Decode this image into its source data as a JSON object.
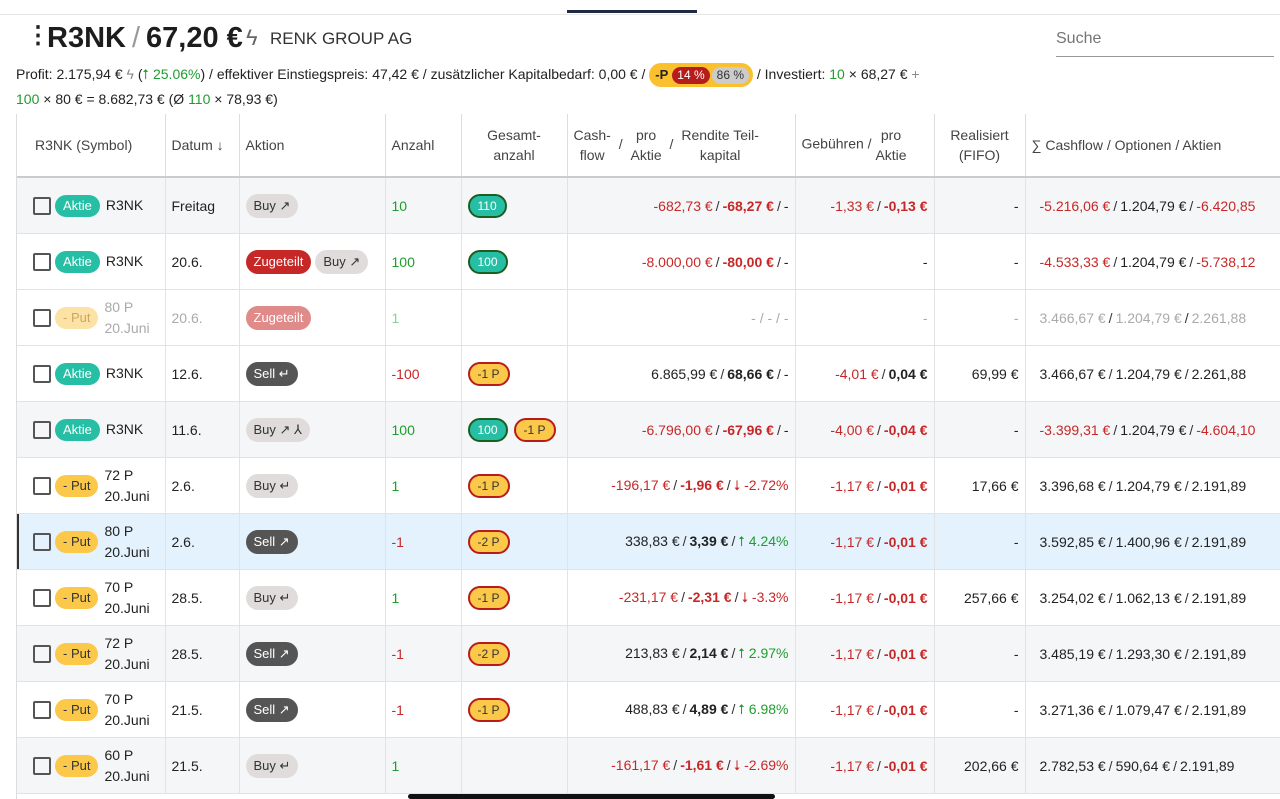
{
  "header": {
    "symbol": "R3NK",
    "price": "67,20 €",
    "company": "RENK GROUP AG",
    "search_placeholder": "Suche"
  },
  "stats": {
    "profit_label": "Profit:",
    "profit_value": "2.175,94 €",
    "profit_pct": "⭡ 25.06%",
    "einstieg_label": "effektiver Einstiegspreis:",
    "einstieg_value": "47,42 €",
    "kapital_label": "zusätzlicher Kapitalbedarf:",
    "kapital_value": "0,00 €",
    "pill_p": "-P",
    "pill_red": "14 %",
    "pill_grey": "86 %",
    "investiert_label": "Investiert:",
    "inv_count1": "10",
    "inv_price1": "68,27 €",
    "inv_count2": "100",
    "inv_price2": "80 €",
    "inv_total": "8.682,73 €",
    "avg_count": "110",
    "avg_price": "78,93 €"
  },
  "columns": {
    "symbol": "R3NK (Symbol)",
    "datum": "Datum",
    "aktion": "Aktion",
    "anzahl": "Anzahl",
    "gesamt1": "Gesamt-",
    "gesamt2": "anzahl",
    "cash1": "Cash-",
    "cash2": "flow",
    "pro1": "pro",
    "pro2": "Aktie",
    "rendite1": "Rendite Teil-",
    "rendite2": "kapital",
    "gebuehren": "Gebühren /",
    "gpro1": "pro",
    "gpro2": "Aktie",
    "real1": "Realisiert",
    "real2": "(FIFO)",
    "cashflow_sum": "∑ Cashflow / Optionen / Aktien"
  },
  "rows": [
    {
      "type": "Aktie",
      "sym": "R3NK",
      "sym2": "",
      "date": "Freitag",
      "actions": [
        "Buy ↗"
      ],
      "anzahl": "10",
      "gesamt": [
        "110"
      ],
      "cash": "-682,73 €",
      "pro": "-68,27 €",
      "rendite": "-",
      "geb": "-1,33 €",
      "gpro": "-0,13 €",
      "real": "-",
      "s1": "-5.216,06 €",
      "s2": "1.204,79 €",
      "s3": "-6.420,85"
    },
    {
      "type": "Aktie",
      "sym": "R3NK",
      "sym2": "",
      "date": "20.6.",
      "actions": [
        "Zugeteilt",
        "Buy ↗"
      ],
      "anzahl": "100",
      "gesamt": [
        "100"
      ],
      "cash": "-8.000,00 €",
      "pro": "-80,00 €",
      "rendite": "-",
      "geb": "",
      "gpro": "-",
      "real": "-",
      "s1": "-4.533,33 €",
      "s2": "1.204,79 €",
      "s3": "-5.738,12"
    },
    {
      "type": "- Put",
      "sym": "80 P",
      "sym2": "20.Juni",
      "date": "20.6.",
      "actions": [
        "Zugeteilt"
      ],
      "anzahl": "1",
      "gesamt": [],
      "cash": "- / - / -",
      "pro": "",
      "rendite": "",
      "geb": "",
      "gpro": "-",
      "real": "-",
      "s1": "3.466,67 €",
      "s2": "1.204,79 €",
      "s3": "2.261,88"
    },
    {
      "type": "Aktie",
      "sym": "R3NK",
      "sym2": "",
      "date": "12.6.",
      "actions": [
        "Sell ↵"
      ],
      "anzahl": "-100",
      "gesamt": [
        "-1 P"
      ],
      "cash": "6.865,99 €",
      "pro": "68,66 €",
      "rendite": "-",
      "geb": "-4,01 €",
      "gpro": "0,04 €",
      "real": "69,99 €",
      "s1": "3.466,67 €",
      "s2": "1.204,79 €",
      "s3": "2.261,88"
    },
    {
      "type": "Aktie",
      "sym": "R3NK",
      "sym2": "",
      "date": "11.6.",
      "actions": [
        "Buy ↗ ⅄"
      ],
      "anzahl": "100",
      "gesamt": [
        "100",
        "-1 P"
      ],
      "cash": "-6.796,00 €",
      "pro": "-67,96 €",
      "rendite": "-",
      "geb": "-4,00 €",
      "gpro": "-0,04 €",
      "real": "-",
      "s1": "-3.399,31 €",
      "s2": "1.204,79 €",
      "s3": "-4.604,10"
    },
    {
      "type": "- Put",
      "sym": "72 P",
      "sym2": "20.Juni",
      "date": "2.6.",
      "actions": [
        "Buy ↵"
      ],
      "anzahl": "1",
      "gesamt": [
        "-1 P"
      ],
      "cash": "-196,17 €",
      "pro": "-1,96 €",
      "rendite": "⭣ -2.72%",
      "geb": "-1,17 €",
      "gpro": "-0,01 €",
      "real": "17,66 €",
      "s1": "3.396,68 €",
      "s2": "1.204,79 €",
      "s3": "2.191,89"
    },
    {
      "type": "- Put",
      "sym": "80 P",
      "sym2": "20.Juni",
      "date": "2.6.",
      "actions": [
        "Sell ↗"
      ],
      "anzahl": "-1",
      "gesamt": [
        "-2 P"
      ],
      "cash": "338,83 €",
      "pro": "3,39 €",
      "rendite": "⭡ 4.24%",
      "geb": "-1,17 €",
      "gpro": "-0,01 €",
      "real": "-",
      "s1": "3.592,85 €",
      "s2": "1.400,96 €",
      "s3": "2.191,89"
    },
    {
      "type": "- Put",
      "sym": "70 P",
      "sym2": "20.Juni",
      "date": "28.5.",
      "actions": [
        "Buy ↵"
      ],
      "anzahl": "1",
      "gesamt": [
        "-1 P"
      ],
      "cash": "-231,17 €",
      "pro": "-2,31 €",
      "rendite": "⭣ -3.3%",
      "geb": "-1,17 €",
      "gpro": "-0,01 €",
      "real": "257,66 €",
      "s1": "3.254,02 €",
      "s2": "1.062,13 €",
      "s3": "2.191,89"
    },
    {
      "type": "- Put",
      "sym": "72 P",
      "sym2": "20.Juni",
      "date": "28.5.",
      "actions": [
        "Sell ↗"
      ],
      "anzahl": "-1",
      "gesamt": [
        "-2 P"
      ],
      "cash": "213,83 €",
      "pro": "2,14 €",
      "rendite": "⭡ 2.97%",
      "geb": "-1,17 €",
      "gpro": "-0,01 €",
      "real": "-",
      "s1": "3.485,19 €",
      "s2": "1.293,30 €",
      "s3": "2.191,89"
    },
    {
      "type": "- Put",
      "sym": "70 P",
      "sym2": "20.Juni",
      "date": "21.5.",
      "actions": [
        "Sell ↗"
      ],
      "anzahl": "-1",
      "gesamt": [
        "-1 P"
      ],
      "cash": "488,83 €",
      "pro": "4,89 €",
      "rendite": "⭡ 6.98%",
      "geb": "-1,17 €",
      "gpro": "-0,01 €",
      "real": "-",
      "s1": "3.271,36 €",
      "s2": "1.079,47 €",
      "s3": "2.191,89"
    },
    {
      "type": "- Put",
      "sym": "60 P",
      "sym2": "20.Juni",
      "date": "21.5.",
      "actions": [
        "Buy ↵"
      ],
      "anzahl": "1",
      "gesamt": [],
      "cash": "-161,17 €",
      "pro": "-1,61 €",
      "rendite": "⭣ -2.69%",
      "geb": "-1,17 €",
      "gpro": "-0,01 €",
      "real": "202,66 €",
      "s1": "2.782,53 €",
      "s2": "590,64 €",
      "s3": "2.191,89"
    }
  ]
}
